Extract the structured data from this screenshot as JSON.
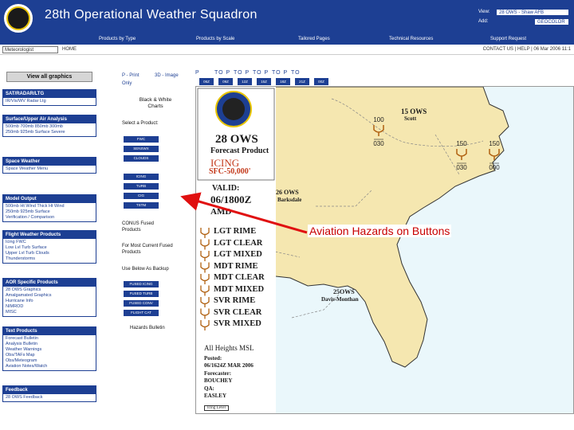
{
  "header": {
    "title": "28th Operational Weather Squadron",
    "view_label": "View:",
    "view_value": "28 OWS - Shaw AFB",
    "add_label": "Add:",
    "add_value": "GEOCOLOR"
  },
  "nav": [
    "Products by Type",
    "Products by Scale",
    "Tailored Pages",
    "Technical Resources",
    "Support Request"
  ],
  "crumb": {
    "select": "Meteorologist",
    "home": "HOME",
    "contact": "CONTACT US | HELP | 06 Mar 2006 11:1"
  },
  "sidebar": {
    "view_all": "View all graphics",
    "sections": [
      {
        "title": "SAT/RADAR/LTG",
        "lines": [
          "IR/Vis/WV Radar Ltg"
        ]
      },
      {
        "title": "Surface/Upper Air Analysis",
        "lines": [
          "500mb 700mb 850mb 300mb",
          "250mb 925mb Surface Severe"
        ]
      },
      {
        "title": "Space Weather",
        "lines": [
          "Space Weather Menu"
        ]
      },
      {
        "title": "Model Output",
        "lines": [
          "500mb Ht Wind Thick Ht Wind",
          "250mb 925mb Surface",
          "Verification / Comparison"
        ]
      },
      {
        "title": "Flight Weather Products",
        "lines": [
          "Icing         FWC",
          "Low Lvl Turb  Surface",
          "Upper Lvl Turb  Clouds",
          "Thunderstorms"
        ]
      },
      {
        "title": "AOR Specific Products",
        "lines": [
          "28 OWS Graphics",
          "Amalgamated Graphics",
          "Hurricane Info",
          "NIMROD",
          "MISC"
        ]
      },
      {
        "title": "Text Products",
        "lines": [
          "Forecast Bulletin",
          "Analysis Bulletin",
          "Weather Warnings",
          "Obs/TAFs Map",
          "Obs/Meteogram",
          "Aviation Notes/Watch"
        ]
      },
      {
        "title": "Feedback",
        "lines": [
          "28 OWS Feedback"
        ]
      }
    ]
  },
  "middle": {
    "bw": "Black & White Charts",
    "select": "Select a Product:",
    "product_buttons": [
      "FWC",
      "SENSWX",
      "CLOUDS",
      "ICING",
      "TURB",
      "CIG",
      "TSTM"
    ],
    "conus": "CONUS Fused Products",
    "most_current": "For Most Current Fused Products",
    "backup": "Use Below As Backup",
    "backup_buttons": [
      "FUSED ICING",
      "FUSED TURB",
      "FUSED CONV",
      "FLIGHT CAT"
    ],
    "hazards": "Hazards Bulletin"
  },
  "top_controls": {
    "print": "P - Print",
    "image": "3D - Image",
    "only": "Only",
    "tabs": [
      "06Z",
      "09Z",
      "12Z",
      "15Z",
      "18Z",
      "21Z",
      "00Z"
    ],
    "p_labels": [
      "P",
      "TO P",
      "TO P",
      "TO P",
      "TO P",
      "TO"
    ]
  },
  "map": {
    "logo_text": "28 OWS",
    "subtitle": "Forecast Product",
    "product": "ICING",
    "level": "SFC-50,000'",
    "valid_label": "VALID:",
    "valid": "06/1800Z",
    "amd": "AMD",
    "legend": [
      "LGT RIME",
      "LGT CLEAR",
      "LGT MIXED",
      "MDT RIME",
      "MDT CLEAR",
      "MDT MIXED",
      "SVR RIME",
      "SVR CLEAR",
      "SVR MIXED"
    ],
    "heights": "All Heights MSL",
    "posted_label": "Posted:",
    "posted": "06/1624Z MAR 2006",
    "forecaster_label": "Forecaster:",
    "forecaster": "BOUCHEY",
    "qa_label": "QA:",
    "qa": "EASLEY",
    "stamp": "Icing Level",
    "region_15ows": "15 OWS",
    "region_scott": "Scott",
    "region_26ows": "26 OWS",
    "region_barksdale": "Barksdale",
    "region_25ows": "25OWS",
    "region_davis": "Davis-Monthan",
    "icing_pairs": [
      [
        "100",
        "030"
      ],
      [
        "150",
        "030"
      ],
      [
        "150",
        "000"
      ]
    ]
  },
  "annotation": "Aviation Hazards on Buttons",
  "colors": {
    "nav": "#1d3f93",
    "land": "#f5e7b0",
    "ocean": "#e9f6fa",
    "arrow": "#e01010"
  }
}
